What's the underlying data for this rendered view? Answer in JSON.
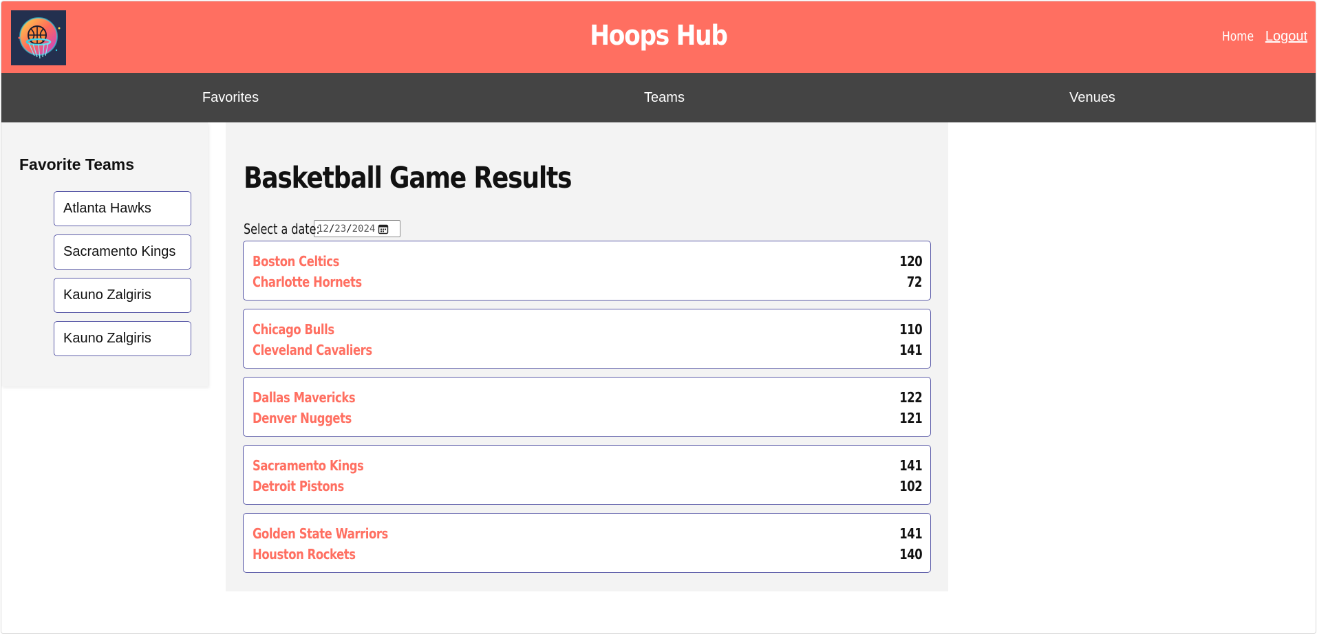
{
  "header": {
    "title": "Hoops Hub",
    "logo_icon": "basketball-logo-icon",
    "links": {
      "home": "Home",
      "logout": "Logout"
    },
    "color": "#ff6f61"
  },
  "nav": {
    "items": [
      {
        "label": "Favorites"
      },
      {
        "label": "Teams"
      },
      {
        "label": "Venues"
      }
    ],
    "color": "#444444"
  },
  "sidebar": {
    "title": "Favorite Teams",
    "favorites": [
      {
        "name": "Atlanta Hawks"
      },
      {
        "name": "Sacramento Kings"
      },
      {
        "name": "Kauno Zalgiris"
      },
      {
        "name": "Kauno Zalgiris"
      }
    ]
  },
  "main": {
    "title": "Basketball Game Results",
    "date_label": "Select a date:",
    "date": {
      "month": "12",
      "day": "23",
      "year": "2024"
    },
    "games": [
      {
        "home": {
          "name": "Boston Celtics",
          "score": "120"
        },
        "away": {
          "name": "Charlotte Hornets",
          "score": "72"
        }
      },
      {
        "home": {
          "name": "Chicago Bulls",
          "score": "110"
        },
        "away": {
          "name": "Cleveland Cavaliers",
          "score": "141"
        }
      },
      {
        "home": {
          "name": "Dallas Mavericks",
          "score": "122"
        },
        "away": {
          "name": "Denver Nuggets",
          "score": "121"
        }
      },
      {
        "home": {
          "name": "Sacramento Kings",
          "score": "141"
        },
        "away": {
          "name": "Detroit Pistons",
          "score": "102"
        }
      },
      {
        "home": {
          "name": "Golden State Warriors",
          "score": "141"
        },
        "away": {
          "name": "Houston Rockets",
          "score": "140"
        }
      }
    ],
    "team_color": "#ff6f61",
    "card_border_color": "#5b5ba8"
  }
}
